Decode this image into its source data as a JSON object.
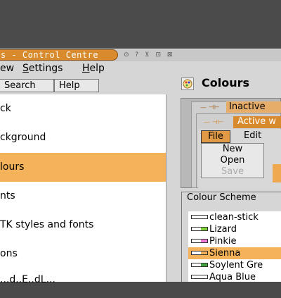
{
  "window": {
    "title": "s - Control Centre",
    "title_buttons": "⊙ ? ⊻ ⊡ ⊠"
  },
  "menubar": {
    "items": [
      {
        "label": "ew"
      },
      {
        "label": "Settings"
      },
      {
        "label": "Help"
      }
    ]
  },
  "toolbar": {
    "search_label": "Search",
    "help_label": "Help"
  },
  "sidebar": {
    "items": [
      {
        "label": "ck"
      },
      {
        "label": "ckground"
      },
      {
        "label": "lours"
      },
      {
        "label": "nts"
      },
      {
        "label": "TK styles and fonts"
      },
      {
        "label": "ons"
      },
      {
        "label": "...d..E..dL..."
      }
    ],
    "selected_index": 2
  },
  "panel": {
    "title": "Colours",
    "icon": "colours-icon"
  },
  "preview": {
    "inactive_label": "Inactive",
    "active_label": "Active w",
    "file_label": "File",
    "edit_label": "Edit",
    "menu_items": [
      "New",
      "Open",
      "Save"
    ]
  },
  "scheme": {
    "legend": "Colour Scheme",
    "items": [
      {
        "label": "clean-stick",
        "color": "#ffffff"
      },
      {
        "label": "Lizard",
        "color": "#7fd23c"
      },
      {
        "label": "Pinkie",
        "color": "#f37ad6"
      },
      {
        "label": "Sienna",
        "color": "#f4b35a"
      },
      {
        "label": "Soylent Gre",
        "color": "#3fa33f"
      },
      {
        "label": "Aqua Blue",
        "color": "#ffffff"
      }
    ],
    "selected_index": 3
  },
  "colors": {
    "accent": "#d98a2c",
    "selection": "#f4b35a"
  }
}
